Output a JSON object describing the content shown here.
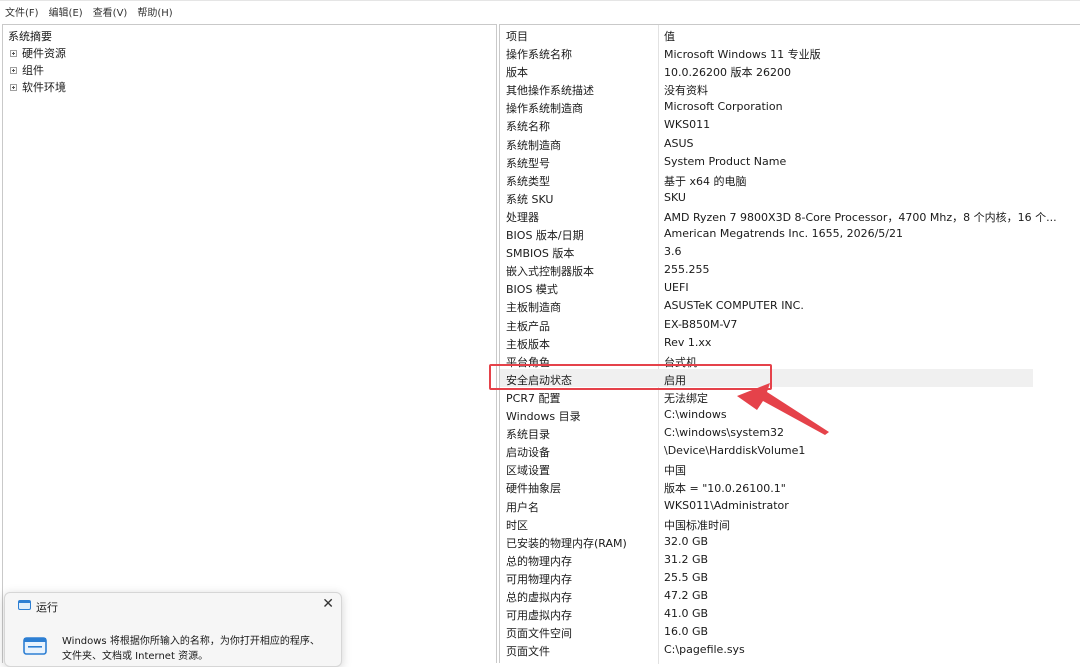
{
  "menubar": {
    "items": [
      "文件(F)",
      "编辑(E)",
      "查看(V)",
      "帮助(H)"
    ]
  },
  "tree": {
    "root": "系统摘要",
    "nodes": [
      "硬件资源",
      "组件",
      "软件环境"
    ]
  },
  "list": {
    "header": {
      "key": "项目",
      "value": "值"
    },
    "rows": [
      {
        "key": "操作系统名称",
        "value": "Microsoft Windows 11 专业版"
      },
      {
        "key": "版本",
        "value": "10.0.26200 版本 26200"
      },
      {
        "key": "其他操作系统描述",
        "value": "没有资料"
      },
      {
        "key": "操作系统制造商",
        "value": "Microsoft Corporation"
      },
      {
        "key": "系统名称",
        "value": "WKS011"
      },
      {
        "key": "系统制造商",
        "value": "ASUS"
      },
      {
        "key": "系统型号",
        "value": "System Product Name"
      },
      {
        "key": "系统类型",
        "value": "基于 x64 的电脑"
      },
      {
        "key": "系统 SKU",
        "value": "SKU"
      },
      {
        "key": "处理器",
        "value": "AMD Ryzen 7 9800X3D 8-Core Processor，4700 Mhz，8 个内核，16 个..."
      },
      {
        "key": "BIOS 版本/日期",
        "value": "American Megatrends Inc. 1655, 2026/5/21"
      },
      {
        "key": "SMBIOS 版本",
        "value": "3.6"
      },
      {
        "key": "嵌入式控制器版本",
        "value": "255.255"
      },
      {
        "key": "BIOS 模式",
        "value": "UEFI"
      },
      {
        "key": "主板制造商",
        "value": "ASUSTeK COMPUTER INC."
      },
      {
        "key": "主板产品",
        "value": "EX-B850M-V7"
      },
      {
        "key": "主板版本",
        "value": "Rev 1.xx"
      },
      {
        "key": "平台角色",
        "value": "台式机"
      },
      {
        "key": "安全启动状态",
        "value": "启用"
      },
      {
        "key": "PCR7 配置",
        "value": "无法绑定"
      },
      {
        "key": "Windows 目录",
        "value": "C:\\windows"
      },
      {
        "key": "系统目录",
        "value": "C:\\windows\\system32"
      },
      {
        "key": "启动设备",
        "value": "\\Device\\HarddiskVolume1"
      },
      {
        "key": "区域设置",
        "value": "中国"
      },
      {
        "key": "硬件抽象层",
        "value": "版本 = \"10.0.26100.1\""
      },
      {
        "key": "用户名",
        "value": "WKS011\\Administrator"
      },
      {
        "key": "时区",
        "value": "中国标准时间"
      },
      {
        "key": "已安装的物理内存(RAM)",
        "value": "32.0 GB"
      },
      {
        "key": "总的物理内存",
        "value": "31.2 GB"
      },
      {
        "key": "可用物理内存",
        "value": "25.5 GB"
      },
      {
        "key": "总的虚拟内存",
        "value": "47.2 GB"
      },
      {
        "key": "可用虚拟内存",
        "value": "41.0 GB"
      },
      {
        "key": "页面文件空间",
        "value": "16.0 GB"
      },
      {
        "key": "页面文件",
        "value": "C:\\pagefile.sys"
      }
    ]
  },
  "run_dialog": {
    "title": "运行",
    "close_label": "✕",
    "line1": "Windows 将根据你所输入的名称，为你打开相应的程序、",
    "line2": "文件夹、文档或 Internet 资源。"
  },
  "colors": {
    "annotation": "#e5424a",
    "selected_row": "#f0f0f0",
    "border": "#c9c9c9"
  }
}
